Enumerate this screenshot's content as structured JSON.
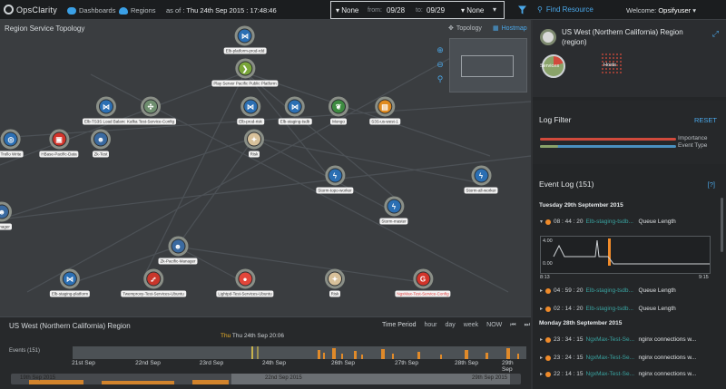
{
  "app": {
    "logo": "OpsClarity",
    "nav": [
      "Dashboards",
      "Regions"
    ],
    "asof_label": "as of :",
    "asof_value": "Thu 24th Sep 2015 : 17:48:46"
  },
  "range": {
    "left_select": "None",
    "from_label": "from:",
    "from_value": "09/28",
    "to_label": "to:",
    "to_value": "09/29",
    "right_select": "None"
  },
  "find_resource": "Find Resource",
  "welcome": {
    "label": "Welcome:",
    "user": "Opsifyuser"
  },
  "topology": {
    "title": "Region Service Topology",
    "toggles": [
      "Topology",
      "Hostmap"
    ],
    "nodes": [
      {
        "label": "Elb-platform-prod-rdd",
        "color": "#2b6fb3",
        "glyph": "⋈",
        "red": false
      },
      {
        "label": "Play Server Pacific Public Platform",
        "color": "#7aa63a",
        "glyph": "❯",
        "red": false
      },
      {
        "label": "Elb-TS3S Load Balance",
        "color": "#2b6fb3",
        "glyph": "⋈",
        "red": false
      },
      {
        "label": "Kafka Test-Service-Config",
        "color": "#6f8f6f",
        "glyph": "✣",
        "red": false
      },
      {
        "label": "Elb-prod-risk",
        "color": "#2b6fb3",
        "glyph": "⋈",
        "red": false
      },
      {
        "label": "Elb-staging-tsdb",
        "color": "#2b6fb3",
        "glyph": "⋈",
        "red": false
      },
      {
        "label": "Mongo",
        "color": "#3d8b40",
        "glyph": "❦",
        "red": false
      },
      {
        "label": "S3S-us-west-1",
        "color": "#e08a1e",
        "glyph": "▤",
        "red": false
      },
      {
        "label": "Trello Write",
        "color": "#2b6fb3",
        "glyph": "◎",
        "red": false
      },
      {
        "label": "HBase-Pacific-Data",
        "color": "#d2342a",
        "glyph": "▣",
        "red": false
      },
      {
        "label": "Zk-Test",
        "color": "#3a6aa0",
        "glyph": "☻",
        "red": false
      },
      {
        "label": "Risk",
        "color": "#d8c19a",
        "glyph": "✦",
        "red": false
      },
      {
        "label": "Storm-topo-worker",
        "color": "#2b6fb3",
        "glyph": "ϟ",
        "red": false
      },
      {
        "label": "Storm-all-worker",
        "color": "#2b6fb3",
        "glyph": "ϟ",
        "red": false
      },
      {
        "label": "Manager",
        "color": "#3a6aa0",
        "glyph": "☻",
        "red": false
      },
      {
        "label": "Storm-master",
        "color": "#2b6fb3",
        "glyph": "ϟ",
        "red": false
      },
      {
        "label": "Zk-Pacific-Manager",
        "color": "#3a6aa0",
        "glyph": "☻",
        "red": false
      },
      {
        "label": "Elb-staging-platform",
        "color": "#2b6fb3",
        "glyph": "⋈",
        "red": false
      },
      {
        "label": "Twemproxy-Test-Services-Ubuntu",
        "color": "#c9362b",
        "glyph": "⑇",
        "red": false
      },
      {
        "label": "Lightpd-Test-Services-Ubuntu",
        "color": "#e2463a",
        "glyph": "●",
        "red": false
      },
      {
        "label": "Risk",
        "color": "#d8c19a",
        "glyph": "✦",
        "red": false
      },
      {
        "label": "NgxMax-Test-Service-Config",
        "color": "#d2342a",
        "glyph": "G",
        "red": true
      }
    ]
  },
  "timeline": {
    "title": "US West (Northern California) Region",
    "period_label": "Time Period",
    "periods": [
      "hour",
      "day",
      "week",
      "NOW"
    ],
    "marker_key": "Thu",
    "marker_value": "Thu 24th Sep 20:06",
    "events_label": "Events (151)",
    "axis": [
      "21st Sep",
      "22nd Sep",
      "23rd Sep",
      "24th Sep",
      "26th Sep",
      "27th Sep",
      "28th Sep",
      "29th Sep"
    ],
    "nav_labels": [
      "19th Sep 2015",
      "22nd Sep 2015",
      "29th Sep 2015"
    ]
  },
  "region": {
    "title": "US West (Northern California) Region",
    "subtitle": "(region)",
    "services_label": "Services",
    "hosts_label": "Hosts"
  },
  "log_filter": {
    "title": "Log Filter",
    "reset": "RESET",
    "importance": "Importance",
    "event_type": "Event Type"
  },
  "event_log": {
    "title": "Event Log (151)",
    "help": "[?]",
    "days": [
      "Tuesday 29th September 2015",
      "Monday 28th September 2015"
    ],
    "rows": [
      {
        "time": "08 : 44 : 20",
        "name": "Elb-staging-tsdb...",
        "metric": "Queue Length"
      },
      {
        "time": "04 : 59 : 20",
        "name": "Elb-staging-tsdb...",
        "metric": "Queue Length"
      },
      {
        "time": "02 : 14 : 20",
        "name": "Elb-staging-tsdb...",
        "metric": "Queue Length"
      },
      {
        "time": "23 : 34 : 15",
        "name": "NgxMax-Test-Se...",
        "metric": "nginx connections w..."
      },
      {
        "time": "23 : 24 : 15",
        "name": "NgxMax-Test-Se...",
        "metric": "nginx connections w..."
      },
      {
        "time": "22 : 14 : 15",
        "name": "NgxMax-Test-Se...",
        "metric": "nginx connections w..."
      }
    ],
    "mini_chart": {
      "ymax": "4.00",
      "ymin": "0.00",
      "xstart": "8:13",
      "xend": "9:15"
    }
  },
  "colors": {
    "accent": "#4aa7e8",
    "orange": "#f08b2a",
    "teal": "#39a3a0",
    "importance": "#d14a3c",
    "eventtype": "#4a90c0"
  }
}
